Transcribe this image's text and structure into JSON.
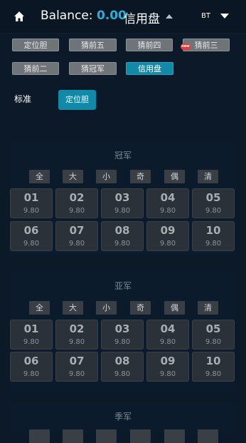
{
  "header": {
    "balance_label": "Balance:",
    "balance_value": "0.00",
    "mode": "信用盘",
    "bt": "BT"
  },
  "tabs": [
    {
      "label": "定位胆",
      "active": false
    },
    {
      "label": "猜前五",
      "active": false
    },
    {
      "label": "猜前四",
      "active": false
    },
    {
      "label": "猜前三",
      "active": false,
      "badge": "new"
    },
    {
      "label": "猜前二",
      "active": false
    },
    {
      "label": "猜冠军",
      "active": false
    },
    {
      "label": "信用盘",
      "active": true
    }
  ],
  "standard": {
    "label": "标准",
    "button": "定位胆"
  },
  "quick_labels": [
    "全",
    "大",
    "小",
    "奇",
    "偶",
    "清"
  ],
  "sections": [
    {
      "title": "冠军",
      "numbers": [
        "01",
        "02",
        "03",
        "04",
        "05",
        "06",
        "07",
        "08",
        "09",
        "10"
      ],
      "odds": "9.80"
    },
    {
      "title": "亚军",
      "numbers": [
        "01",
        "02",
        "03",
        "04",
        "05",
        "06",
        "07",
        "08",
        "09",
        "10"
      ],
      "odds": "9.80"
    },
    {
      "title": "季军",
      "numbers": [],
      "odds": ""
    }
  ],
  "colors": {
    "accent": "#108aa8",
    "balance": "#2ab0d6",
    "background": "#0b1929",
    "badge": "#e23b3b"
  }
}
